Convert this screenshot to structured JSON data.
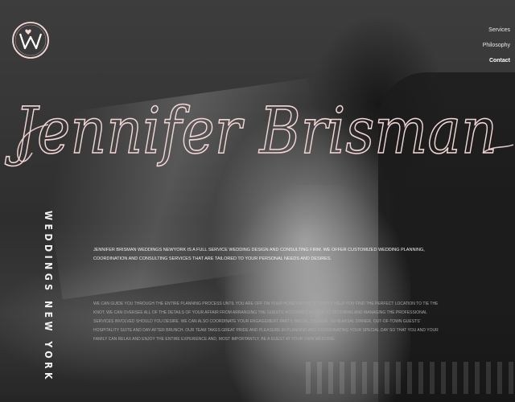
{
  "brand": {
    "logo_alt": "W monogram logo",
    "title": "Jennifer Brisman",
    "side_label": "WEDDINGS NEW YORK"
  },
  "nav": {
    "items": [
      {
        "label": "Services",
        "active": false
      },
      {
        "label": "Philosophy",
        "active": false
      },
      {
        "label": "Contact",
        "active": true
      }
    ]
  },
  "content": {
    "intro": "JENNIFER BRISMAN WEDDINGS NEWYORK IS A FULL SERVICE WEDDING DESIGN AND CONSULTING FIRM. WE OFFER CUSTOMIZED WEDDING PLANNING, COORDINATION AND CONSULTING SERVICES THAT ARE TAILORED TO YOUR PERSONAL NEEDS AND DESIRES.",
    "body": "WE CAN GUIDE YOU THROUGH THE ENTIRE PLANNING PROCESS UNTIL YOU ARE OFF ON YOUR HONEYMOON OR SIMPLY HELP YOU FIND THE PERFECT LOCATION TO TIE THE KNOT. WE CAN OVERSEE ALL OF THE DETAILS OF YOUR AFFAIR FROM ARRANGING THE GUESTS' ACCOMMODATIONS TO SECURING AND MANAGING THE PROFESSIONAL SERVICES INVOLVED SHOULD YOU DESIRE. WE CAN ALSO COORDINATE YOUR ENGAGEMENT PARTY, BRIDAL SHOWER, REHEARSAL DINNER, OUT-OF-TOWN GUESTS' HOSPITALITY SUITE AND DAY-AFTER BRUNCH. OUR TEAM TAKES GREAT PRIDE AND PLEASURE IN PLANNING AND COORDINATING YOUR SPECIAL DAY SO THAT YOU AND YOUR FAMILY CAN RELAX AND ENJOY THE ENTIRE EXPERIENCE AND, MOST IMPORTANTLY, BE A GUEST AT YOUR OWN WEDDING."
  },
  "colors": {
    "accent_pink": "#f3d6d6",
    "text_light": "#f2f2f2",
    "text_muted": "#a9a9a9"
  },
  "icons": {
    "logo": "w-monogram-icon"
  }
}
